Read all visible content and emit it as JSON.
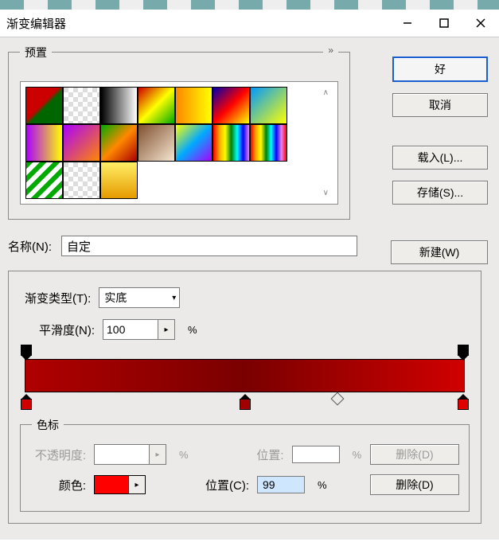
{
  "window": {
    "title": "渐变编辑器"
  },
  "buttons": {
    "ok": "好",
    "cancel": "取消",
    "load": "载入(L)...",
    "save": "存储(S)...",
    "new": "新建(W)"
  },
  "presets": {
    "label": "预置",
    "expand_glyph": "»",
    "swatches": [
      {
        "bg": "linear-gradient(135deg,#c00 0%,#c00 45%,#060 55%,#060 100%)"
      },
      {
        "bg": "repeating-conic-gradient(#fff 0 25%,#ddd 0 50%)",
        "bgsize": "12px 12px"
      },
      {
        "bg": "linear-gradient(90deg,#000,#fff)"
      },
      {
        "bg": "linear-gradient(135deg,#c00,#ff0,#0a0)"
      },
      {
        "bg": "linear-gradient(90deg,#f80,#ff0)"
      },
      {
        "bg": "linear-gradient(135deg,#00a,#f00,#ff0)"
      },
      {
        "bg": "linear-gradient(135deg,#09f,#ff0)"
      },
      {
        "bg": "linear-gradient(90deg,#a0f,#ff0)"
      },
      {
        "bg": "linear-gradient(135deg,#a0f,#f80)"
      },
      {
        "bg": "linear-gradient(135deg,#0a0,#f80,#a00)"
      },
      {
        "bg": "linear-gradient(135deg,#805030,#f5e6d0)"
      },
      {
        "bg": "linear-gradient(135deg,#ff0,#0af,#a0f)"
      },
      {
        "bg": "linear-gradient(90deg,red,orange,yellow,green,cyan,blue,violet)"
      },
      {
        "bg": "linear-gradient(90deg,red,orange,yellow,green,cyan,blue,violet,red)"
      },
      {
        "bg": "repeating-linear-gradient(135deg,#0a0 0 6px,#fff 6px 12px)"
      },
      {
        "bg": "repeating-conic-gradient(#fff 0 25%,#ddd 0 50%)",
        "bgsize": "12px 12px"
      },
      {
        "bg": "linear-gradient(180deg,#ffef66,#e69a00)"
      }
    ]
  },
  "name": {
    "label": "名称(N):",
    "value": "自定"
  },
  "gradient": {
    "type_label": "渐变类型(T):",
    "type_value": "实底",
    "smooth_label": "平滑度(N):",
    "smooth_value": "100",
    "pct": "%",
    "opacity_stops": [
      {
        "pos": 0,
        "color": "#000"
      },
      {
        "pos": 100,
        "color": "#000"
      }
    ],
    "color_stops": [
      {
        "pos": 0,
        "color": "#d00000"
      },
      {
        "pos": 50,
        "color": "#a00000"
      },
      {
        "pos": 100,
        "color": "#e00000"
      }
    ],
    "midpoint": 70
  },
  "stops": {
    "group_label": "色标",
    "opacity_label": "不透明度:",
    "opacity_value": "",
    "pos_label": "位置:",
    "pos_label_c": "位置(C):",
    "pos_value_top": "",
    "color_label": "颜色:",
    "color_value": "#ff0000",
    "pos_value_bottom": "99",
    "delete_label": "删除(D)",
    "pct": "%"
  }
}
